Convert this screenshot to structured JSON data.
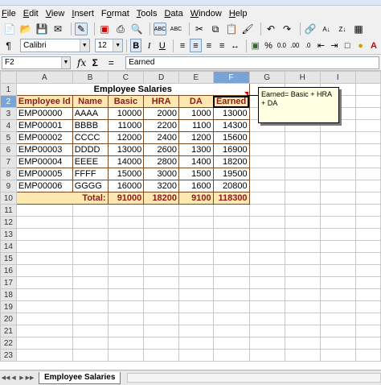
{
  "menu": [
    "File",
    "Edit",
    "View",
    "Insert",
    "Format",
    "Tools",
    "Data",
    "Window",
    "Help"
  ],
  "menu_underline": [
    "F",
    "E",
    "V",
    "I",
    "o",
    "T",
    "D",
    "W",
    "H"
  ],
  "font_name": "Calibri",
  "font_size": "12",
  "cell_ref": "F2",
  "formula_content": "Earned",
  "columns": [
    "A",
    "B",
    "C",
    "D",
    "E",
    "F",
    "G",
    "H",
    "I"
  ],
  "selected_column": "F",
  "selected_row": 2,
  "sheet_title": "Employee Salaries",
  "headers": [
    "Employee Id",
    "Name",
    "Basic",
    "HRA",
    "DA",
    "Earned"
  ],
  "rows": [
    [
      "EMP00000",
      "AAAA",
      "10000",
      "2000",
      "1000",
      "13000"
    ],
    [
      "EMP00001",
      "BBBB",
      "11000",
      "2200",
      "1100",
      "14300"
    ],
    [
      "EMP00002",
      "CCCC",
      "12000",
      "2400",
      "1200",
      "15600"
    ],
    [
      "EMP00003",
      "DDDD",
      "13000",
      "2600",
      "1300",
      "16900"
    ],
    [
      "EMP00004",
      "EEEE",
      "14000",
      "2800",
      "1400",
      "18200"
    ],
    [
      "EMP00005",
      "FFFF",
      "15000",
      "3000",
      "1500",
      "19500"
    ],
    [
      "EMP00006",
      "GGGG",
      "16000",
      "3200",
      "1600",
      "20800"
    ]
  ],
  "total_label": "Total:",
  "totals": [
    "91000",
    "18200",
    "9100",
    "118300"
  ],
  "comment_text": "Earned= Basic + HRA + DA",
  "sheet_tab": "Employee Salaries",
  "colors": {
    "header_fill": "#fde9b0",
    "header_text": "#8b1a1a",
    "selection": "#7ba4d6",
    "comment_bg": "#ffffe1"
  }
}
